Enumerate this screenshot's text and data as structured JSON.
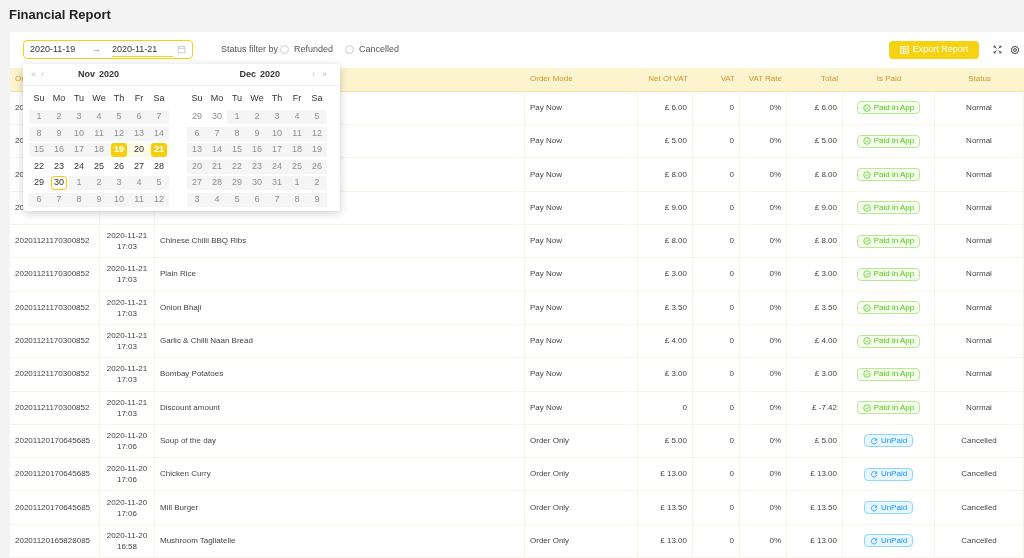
{
  "title": "Financial Report",
  "filter": {
    "start": "2020-11-19",
    "arrow": "→",
    "end": "2020-11-21",
    "label": "Status filter by",
    "options": [
      {
        "label": "Refunded",
        "selected": false
      },
      {
        "label": "Cancelled",
        "selected": false
      }
    ],
    "export": "Export Report"
  },
  "table": {
    "columns": [
      {
        "label": "Or"
      },
      {},
      {},
      {
        "label": "Order Mode"
      },
      {
        "label": "Net Of VAT"
      },
      {
        "label": "VAT"
      },
      {
        "label": "VAT Rate"
      },
      {
        "label": "Total"
      },
      {
        "label": "Is Paid"
      },
      {
        "label": "Status"
      }
    ],
    "rows": [
      {
        "order_no": "20",
        "mode": "Pay Now",
        "net": "£ 6.00",
        "vat": "0",
        "rate": "0%",
        "total": "£ 6.00",
        "paid": {
          "kind": "paid",
          "label": "Paid in App"
        },
        "status": "Normal"
      },
      {
        "order_no": "20",
        "mode": "Pay Now",
        "net": "£ 5.00",
        "vat": "0",
        "rate": "0%",
        "total": "£ 5.00",
        "paid": {
          "kind": "paid",
          "label": "Paid in App"
        },
        "status": "Normal"
      },
      {
        "order_no": "20",
        "mode": "Pay Now",
        "net": "£ 8.00",
        "vat": "0",
        "rate": "0%",
        "total": "£ 8.00",
        "paid": {
          "kind": "paid",
          "label": "Paid in App"
        },
        "status": "Normal"
      },
      {
        "order_no": "20",
        "mode": "Pay Now",
        "net": "£ 9.00",
        "vat": "0",
        "rate": "0%",
        "total": "£ 9.00",
        "paid": {
          "kind": "paid",
          "label": "Paid in App"
        },
        "status": "Normal"
      },
      {
        "order_no": "20201121170300852",
        "date": "2020-11-21",
        "time": "17:03",
        "item": "Chinese Chilli BBQ Ribs",
        "mode": "Pay Now",
        "net": "£ 8.00",
        "vat": "0",
        "rate": "0%",
        "total": "£ 8.00",
        "paid": {
          "kind": "paid",
          "label": "Paid in App"
        },
        "status": "Normal"
      },
      {
        "order_no": "20201121170300852",
        "date": "2020-11-21",
        "time": "17:03",
        "item": "Plain Rice",
        "mode": "Pay Now",
        "net": "£ 3.00",
        "vat": "0",
        "rate": "0%",
        "total": "£ 3.00",
        "paid": {
          "kind": "paid",
          "label": "Paid in App"
        },
        "status": "Normal"
      },
      {
        "order_no": "20201121170300852",
        "date": "2020-11-21",
        "time": "17:03",
        "item": "Onion Bhaji",
        "mode": "Pay Now",
        "net": "£ 3.50",
        "vat": "0",
        "rate": "0%",
        "total": "£ 3.50",
        "paid": {
          "kind": "paid",
          "label": "Paid in App"
        },
        "status": "Normal"
      },
      {
        "order_no": "20201121170300852",
        "date": "2020-11-21",
        "time": "17:03",
        "item": "Garlic & Chilli Naan Bread",
        "mode": "Pay Now",
        "net": "£ 4.00",
        "vat": "0",
        "rate": "0%",
        "total": "£ 4.00",
        "paid": {
          "kind": "paid",
          "label": "Paid in App"
        },
        "status": "Normal"
      },
      {
        "order_no": "20201121170300852",
        "date": "2020-11-21",
        "time": "17:03",
        "item": "Bombay Potatoes",
        "mode": "Pay Now",
        "net": "£ 3.00",
        "vat": "0",
        "rate": "0%",
        "total": "£ 3.00",
        "paid": {
          "kind": "paid",
          "label": "Paid in App"
        },
        "status": "Normal"
      },
      {
        "order_no": "20201121170300852",
        "date": "2020-11-21",
        "time": "17:03",
        "item": "Discount amount",
        "mode": "Pay Now",
        "net": "0",
        "vat": "0",
        "rate": "0%",
        "total": "£ -7.42",
        "paid": {
          "kind": "paid",
          "label": "Paid in App"
        },
        "status": "Normal"
      },
      {
        "order_no": "20201120170645685",
        "date": "2020-11-20",
        "time": "17:06",
        "item": "Soup of the day",
        "mode": "Order Only",
        "net": "£ 5.00",
        "vat": "0",
        "rate": "0%",
        "total": "£ 5.00",
        "paid": {
          "kind": "unpaid",
          "label": "UnPaid"
        },
        "status": "Cancelled"
      },
      {
        "order_no": "20201120170645685",
        "date": "2020-11-20",
        "time": "17:06",
        "item": "Chicken Curry",
        "mode": "Order Only",
        "net": "£ 13.00",
        "vat": "0",
        "rate": "0%",
        "total": "£ 13.00",
        "paid": {
          "kind": "unpaid",
          "label": "UnPaid"
        },
        "status": "Cancelled"
      },
      {
        "order_no": "20201120170645685",
        "date": "2020-11-20",
        "time": "17:06",
        "item": "Mill Burger",
        "mode": "Order Only",
        "net": "£ 13.50",
        "vat": "0",
        "rate": "0%",
        "total": "£ 13.50",
        "paid": {
          "kind": "unpaid",
          "label": "UnPaid"
        },
        "status": "Cancelled"
      },
      {
        "order_no": "20201120165828085",
        "date": "2020-11-20",
        "time": "16:58",
        "item": "Mushroom Tagliatelle",
        "mode": "Order Only",
        "net": "£ 13.00",
        "vat": "0",
        "rate": "0%",
        "total": "£ 13.00",
        "paid": {
          "kind": "unpaid",
          "label": "UnPaid"
        },
        "status": "Cancelled"
      }
    ]
  },
  "calendar": {
    "prev_year": "«",
    "prev_month": "‹",
    "next_month": "›",
    "next_year": "»",
    "months": [
      {
        "month": "Nov",
        "year": "2020",
        "weekdays": [
          "Su",
          "Mo",
          "Tu",
          "We",
          "Th",
          "Fr",
          "Sa"
        ],
        "weeks": [
          [
            {
              "d": "1",
              "kind": "disabled"
            },
            {
              "d": "2",
              "kind": "disabled"
            },
            {
              "d": "3",
              "kind": "disabled"
            },
            {
              "d": "4",
              "kind": "disabled"
            },
            {
              "d": "5",
              "kind": "disabled"
            },
            {
              "d": "6",
              "kind": "disabled"
            },
            {
              "d": "7",
              "kind": "disabled"
            }
          ],
          [
            {
              "d": "8",
              "kind": "disabled"
            },
            {
              "d": "9",
              "kind": "disabled"
            },
            {
              "d": "10",
              "kind": "disabled"
            },
            {
              "d": "11",
              "kind": "disabled"
            },
            {
              "d": "12",
              "kind": "disabled"
            },
            {
              "d": "13",
              "kind": "disabled"
            },
            {
              "d": "14",
              "kind": "disabled"
            }
          ],
          [
            {
              "d": "15",
              "kind": "disabled"
            },
            {
              "d": "16",
              "kind": "disabled"
            },
            {
              "d": "17",
              "kind": "disabled"
            },
            {
              "d": "18",
              "kind": "disabled"
            },
            {
              "d": "19",
              "kind": "start"
            },
            {
              "d": "20",
              "kind": "range"
            },
            {
              "d": "21",
              "kind": "end"
            }
          ],
          [
            {
              "d": "22",
              "kind": "normal"
            },
            {
              "d": "23",
              "kind": "normal"
            },
            {
              "d": "24",
              "kind": "normal"
            },
            {
              "d": "25",
              "kind": "normal"
            },
            {
              "d": "26",
              "kind": "normal"
            },
            {
              "d": "27",
              "kind": "normal"
            },
            {
              "d": "28",
              "kind": "normal"
            }
          ],
          [
            {
              "d": "29",
              "kind": "normal"
            },
            {
              "d": "30",
              "kind": "today"
            },
            {
              "d": "1",
              "kind": "disabled"
            },
            {
              "d": "2",
              "kind": "disabled"
            },
            {
              "d": "3",
              "kind": "disabled"
            },
            {
              "d": "4",
              "kind": "disabled"
            },
            {
              "d": "5",
              "kind": "disabled"
            }
          ],
          [
            {
              "d": "6",
              "kind": "disabled"
            },
            {
              "d": "7",
              "kind": "disabled"
            },
            {
              "d": "8",
              "kind": "disabled"
            },
            {
              "d": "9",
              "kind": "disabled"
            },
            {
              "d": "10",
              "kind": "disabled"
            },
            {
              "d": "11",
              "kind": "disabled"
            },
            {
              "d": "12",
              "kind": "disabled"
            }
          ]
        ]
      },
      {
        "month": "Dec",
        "year": "2020",
        "weekdays": [
          "Su",
          "Mo",
          "Tu",
          "We",
          "Th",
          "Fr",
          "Sa"
        ],
        "weeks": [
          [
            {
              "d": "29",
              "kind": "outside"
            },
            {
              "d": "30",
              "kind": "outside"
            },
            {
              "d": "1",
              "kind": "disabled"
            },
            {
              "d": "2",
              "kind": "disabled"
            },
            {
              "d": "3",
              "kind": "disabled"
            },
            {
              "d": "4",
              "kind": "disabled"
            },
            {
              "d": "5",
              "kind": "disabled"
            }
          ],
          [
            {
              "d": "6",
              "kind": "disabled"
            },
            {
              "d": "7",
              "kind": "disabled"
            },
            {
              "d": "8",
              "kind": "disabled"
            },
            {
              "d": "9",
              "kind": "disabled"
            },
            {
              "d": "10",
              "kind": "disabled"
            },
            {
              "d": "11",
              "kind": "disabled"
            },
            {
              "d": "12",
              "kind": "disabled"
            }
          ],
          [
            {
              "d": "13",
              "kind": "disabled"
            },
            {
              "d": "14",
              "kind": "disabled"
            },
            {
              "d": "15",
              "kind": "disabled"
            },
            {
              "d": "16",
              "kind": "disabled"
            },
            {
              "d": "17",
              "kind": "disabled"
            },
            {
              "d": "18",
              "kind": "disabled"
            },
            {
              "d": "19",
              "kind": "disabled"
            }
          ],
          [
            {
              "d": "20",
              "kind": "disabled"
            },
            {
              "d": "21",
              "kind": "disabled"
            },
            {
              "d": "22",
              "kind": "disabled"
            },
            {
              "d": "23",
              "kind": "disabled"
            },
            {
              "d": "24",
              "kind": "disabled"
            },
            {
              "d": "25",
              "kind": "disabled"
            },
            {
              "d": "26",
              "kind": "disabled"
            }
          ],
          [
            {
              "d": "27",
              "kind": "disabled"
            },
            {
              "d": "28",
              "kind": "disabled"
            },
            {
              "d": "29",
              "kind": "disabled"
            },
            {
              "d": "30",
              "kind": "disabled"
            },
            {
              "d": "31",
              "kind": "disabled"
            },
            {
              "d": "1",
              "kind": "disabled"
            },
            {
              "d": "2",
              "kind": "disabled"
            }
          ],
          [
            {
              "d": "3",
              "kind": "disabled"
            },
            {
              "d": "4",
              "kind": "disabled"
            },
            {
              "d": "5",
              "kind": "disabled"
            },
            {
              "d": "6",
              "kind": "disabled"
            },
            {
              "d": "7",
              "kind": "disabled"
            },
            {
              "d": "8",
              "kind": "disabled"
            },
            {
              "d": "9",
              "kind": "disabled"
            }
          ]
        ]
      }
    ]
  }
}
